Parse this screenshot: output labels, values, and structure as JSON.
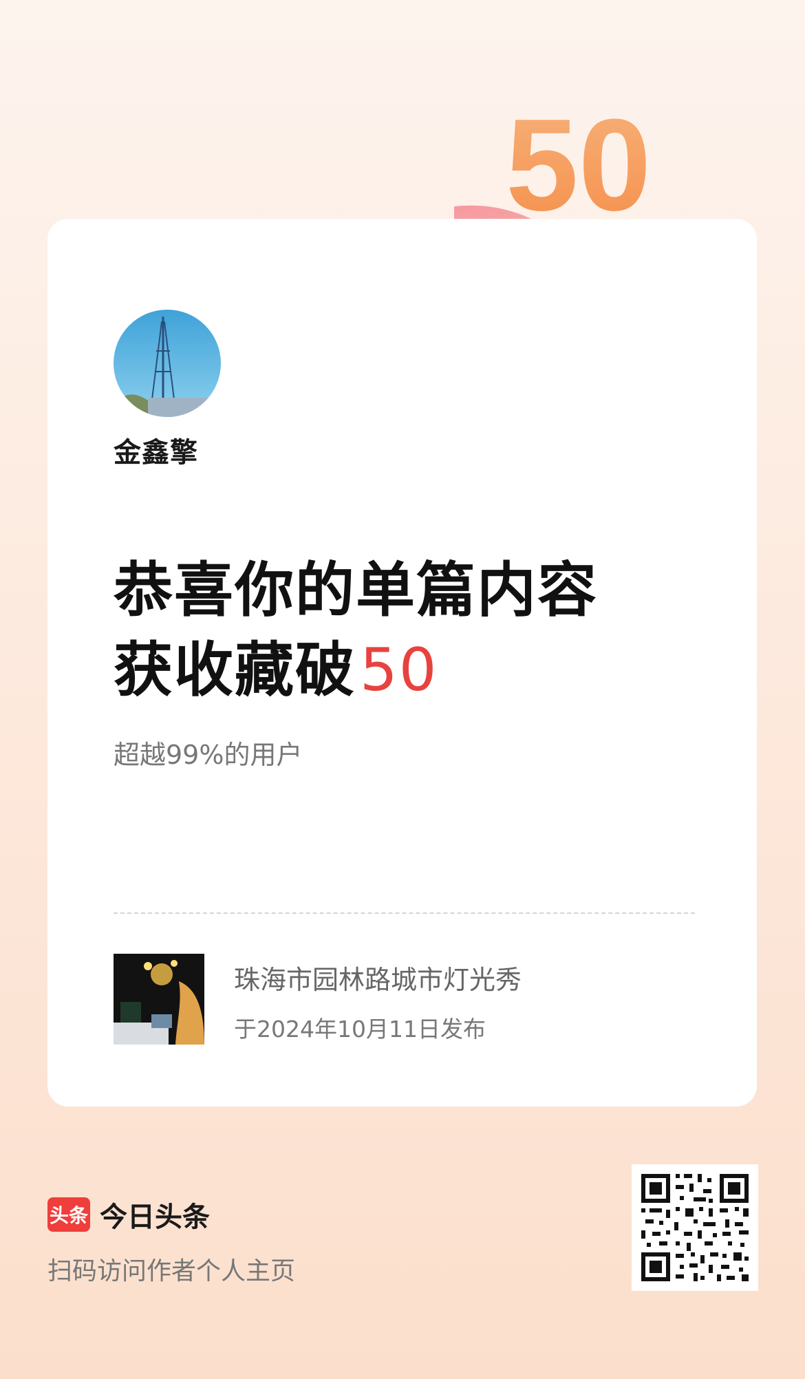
{
  "author": {
    "name": "金鑫擎"
  },
  "achievement": {
    "line1": "恭喜你的单篇内容",
    "line2": "获收藏破",
    "number": "50",
    "badge_number": "50",
    "subline": "超越99%的用户"
  },
  "post": {
    "title": "珠海市园林路城市灯光秀",
    "date": "于2024年10月11日发布"
  },
  "footer": {
    "logo_text": "头条",
    "brand_name": "今日头条",
    "scan_text": "扫码访问作者个人主页"
  },
  "colors": {
    "accent_red": "#e8423f",
    "brand_red": "#ef3e3b",
    "badge_orange": "#f59a4c"
  },
  "icons": {
    "badge": "fifty-ribbon-badge-icon",
    "star": "star-icon"
  }
}
